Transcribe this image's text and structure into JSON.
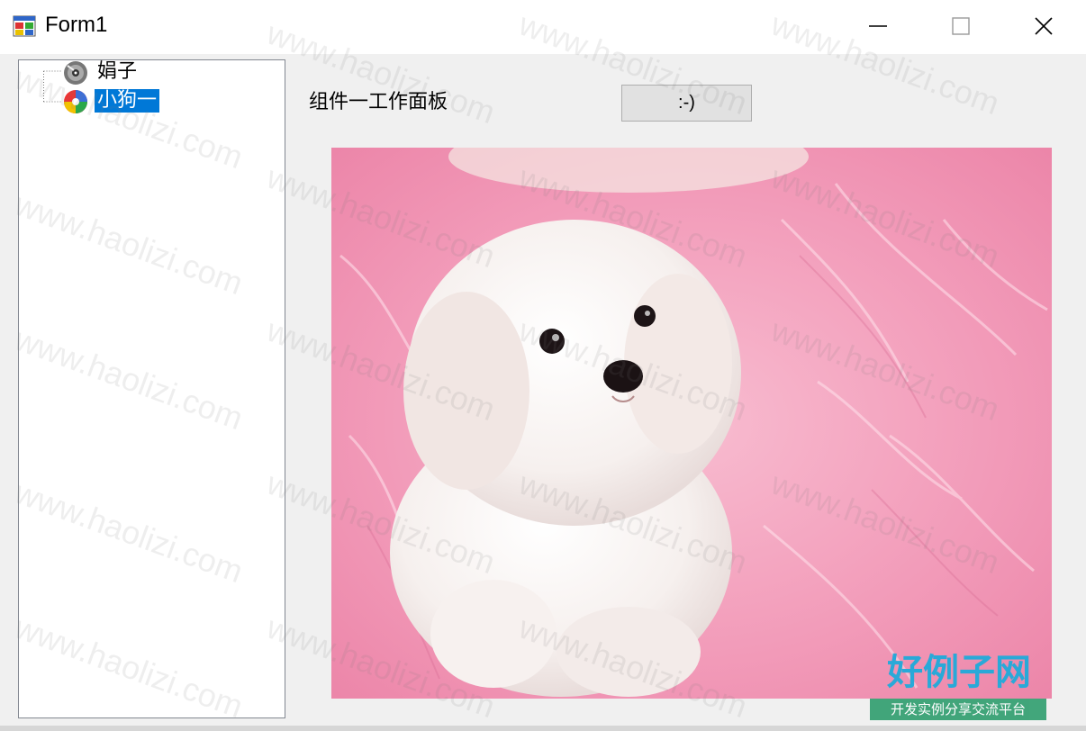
{
  "window": {
    "title": "Form1",
    "icon": "winforms-app-icon",
    "controls": [
      "minimize-icon",
      "maximize-icon",
      "close-icon"
    ]
  },
  "tree": {
    "items": [
      {
        "label": "娟子",
        "icon": "cd-icon",
        "selected": false
      },
      {
        "label": "小狗一",
        "icon": "colorful-disc-icon",
        "selected": true
      }
    ]
  },
  "panel": {
    "label": "组件一工作面板",
    "button_label": ":-)"
  },
  "picture": {
    "subject": "white-puppy-on-pink-fur",
    "watermark_logo": {
      "title": "好例子网",
      "subtitle": "开发实例分享交流平台"
    }
  },
  "watermark_text": "www.haolizi.com",
  "colors": {
    "selection": "#0078d7",
    "background": "#f0f0f0",
    "picture_pink": "#f4a3bf"
  }
}
